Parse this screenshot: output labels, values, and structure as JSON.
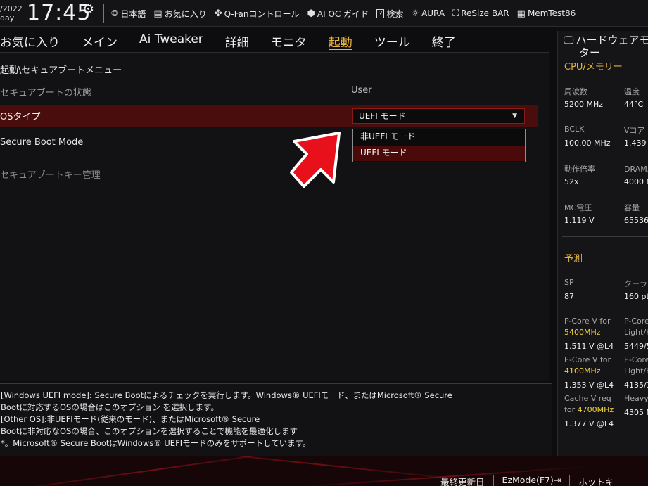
{
  "topbar": {
    "date_line1": "/2022",
    "date_line2": "day",
    "time": "17:45",
    "tools": [
      {
        "icon": "globe-icon",
        "label": "日本語"
      },
      {
        "icon": "favorites-icon",
        "label": "お気に入り"
      },
      {
        "icon": "fan-icon",
        "label": "Q-Fanコントロール"
      },
      {
        "icon": "ai-oc-icon",
        "label": "AI OC ガイド"
      },
      {
        "icon": "help-search-icon",
        "label": "検索"
      },
      {
        "icon": "aura-icon",
        "label": "AURA"
      },
      {
        "icon": "resize-bar-icon",
        "label": "ReSize BAR"
      },
      {
        "icon": "memtest-icon",
        "label": "MemTest86"
      }
    ]
  },
  "tabs": [
    {
      "label": "お気に入り",
      "active": false
    },
    {
      "label": "メイン",
      "active": false
    },
    {
      "label": "Ai Tweaker",
      "active": false
    },
    {
      "label": "詳細",
      "active": false
    },
    {
      "label": "モニタ",
      "active": false
    },
    {
      "label": "起動",
      "active": true
    },
    {
      "label": "ツール",
      "active": false
    },
    {
      "label": "終了",
      "active": false
    }
  ],
  "main": {
    "breadcrumb": "起動\\セキュアブートメニュー",
    "secure_boot_state_label": "セキュアブートの状態",
    "secure_boot_state_value": "User",
    "os_type_label": "OSタイプ",
    "os_type_value": "UEFI モード",
    "secure_boot_mode_label": "Secure Boot Mode",
    "key_management_label": "セキュアブートキー管理",
    "dropdown_options": [
      "非UEFI モード",
      "UEFI モード"
    ]
  },
  "help": {
    "lines": [
      "[Windows UEFI mode]: Secure Bootによるチェックを実行します。Windows® UEFIモード、またはMicrosoft® Secure",
      "Bootに対応するOSの場合はこのオプション を選択します。",
      "[Other OS]:非UEFIモード(従来のモード)、またはMicrosoft® Secure",
      "Bootに非対応なOSの場合、このオプションを選択することで機能を最適化します",
      "*。Microsoft® Secure BootはWindows® UEFIモードのみをサポートしています。"
    ]
  },
  "hardware_monitor": {
    "title_line1": "ハードウェアモ",
    "title_line2": "ター",
    "cpu_section": "CPU/メモリー",
    "freq_label": "周波数",
    "freq_value": "5200 MHz",
    "temp_label": "温度",
    "temp_value": "44°C",
    "bclk_label": "BCLK",
    "bclk_value": "100.00 MHz",
    "vcore_label": "Vコア",
    "vcore_value": "1.439 V",
    "ratio_label": "動作倍率",
    "ratio_value": "52x",
    "dram_label": "DRAM周",
    "dram_value": "4000 M",
    "mc_label": "MC電圧",
    "mc_value": "1.119 V",
    "cap_label": "容量",
    "cap_value": "65536",
    "predict_section": "予測",
    "sp_label": "SP",
    "sp_value": "87",
    "cooler_label": "クーラ",
    "cooler_value": "160 pt",
    "pcore_label": "P-Core V for",
    "pcore_freq": "5400MHz",
    "pcore_value": "1.511 V @L4",
    "pcore2_label": "P-Core",
    "pcore2_sub": "Light/H",
    "pcore2_value": "5449/5",
    "ecore_label": "E-Core V for",
    "ecore_freq": "4100MHz",
    "ecore_value": "1.353 V @L4",
    "ecore2_label": "E-Core",
    "ecore2_sub": "Light/H",
    "ecore2_value": "4135/3",
    "cache_label1": "Cache V req",
    "cache_label2": "for",
    "cache_freq": "4700MHz",
    "cache_value": "1.377 V @L4",
    "heavy_label": "Heavy",
    "heavy_value": "4305 M"
  },
  "footer": {
    "last_modified": "最終更新日",
    "ezmode": "EzMode(F7)⇥",
    "hotkeys": "ホットキ"
  }
}
